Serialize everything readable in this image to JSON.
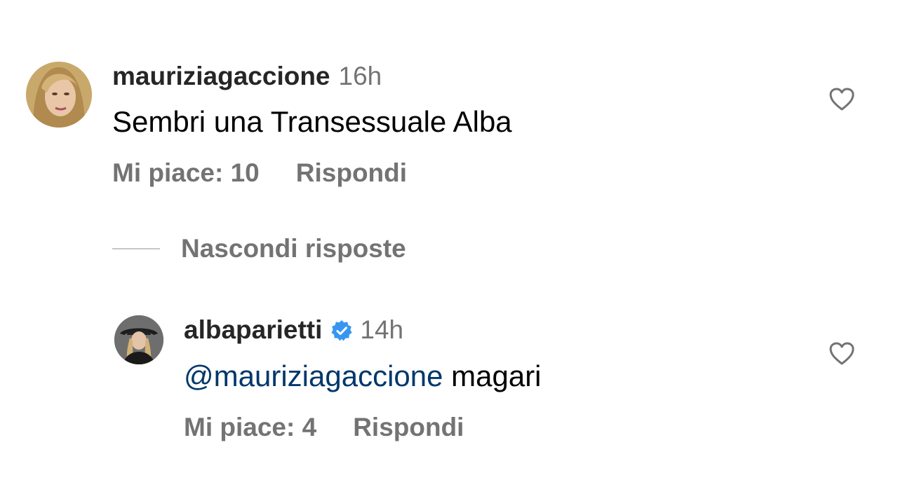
{
  "comment": {
    "username": "mauriziagaccione",
    "time": "16h",
    "text": "Sembri una Transessuale Alba",
    "likes_label": "Mi piace: 10",
    "reply_label": "Rispondi",
    "avatar_icon": "user-avatar-icon",
    "like_icon": "heart-outline-icon"
  },
  "replies_toggle": {
    "label": "Nascondi risposte"
  },
  "reply": {
    "username": "albaparietti",
    "verified_icon": "verified-badge-icon",
    "verified_color": "#3797f0",
    "time": "14h",
    "mention": "@mauriziagaccione",
    "text": " magari",
    "likes_label": "Mi piace: 4",
    "reply_label": "Rispondi",
    "avatar_icon": "user-avatar-icon",
    "like_icon": "heart-outline-icon"
  },
  "colors": {
    "text": "#000000",
    "username": "#262626",
    "secondary": "#737373",
    "mention": "#00376b",
    "divider": "#c7c7c7"
  }
}
